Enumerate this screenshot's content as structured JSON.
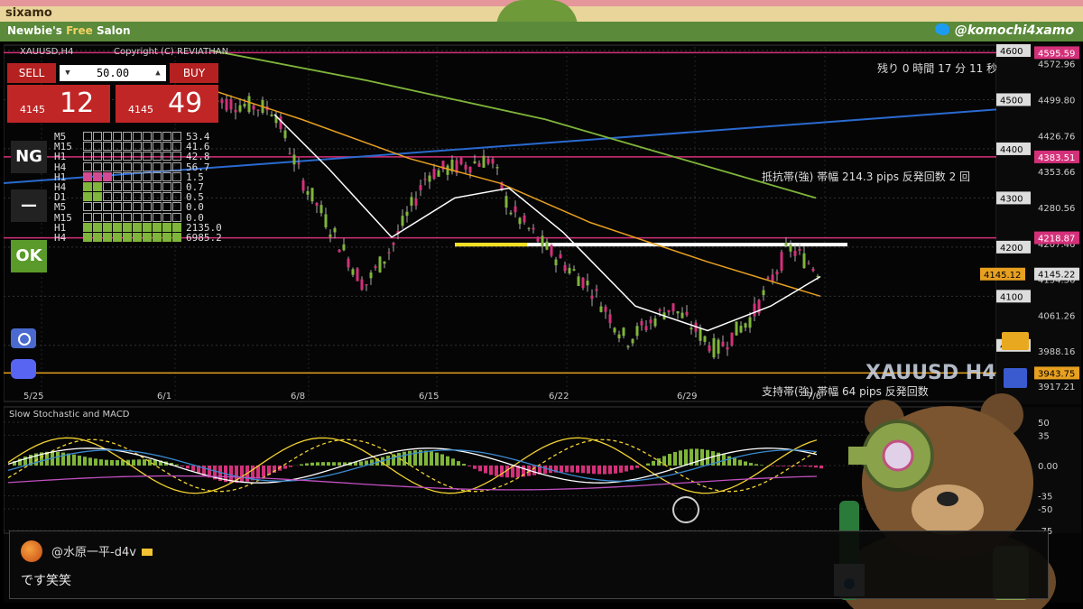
{
  "stream": {
    "brand": "sixamo",
    "salon_prefix": "Newbie's",
    "salon_highlight": "Free",
    "salon_suffix": "Salon",
    "twitter": "@komochi4xamo"
  },
  "chart": {
    "symbol_title": "XAUUSD,H4",
    "copyright": "Copyright (C) REVIATHAN",
    "countdown": "残り 0 時間 17 分 11 秒",
    "resistance_note": "抵抗帯(強) 帯幅 214.3 pips 反発回数 2 回",
    "support_note": "支持帯(強) 帯幅 64 pips 反発回数",
    "watermark": "XAUUSD H4",
    "subwindow_title": "Slow Stochastic and MACD",
    "price_axis": [
      "4572.96",
      "4499.80",
      "4426.76",
      "4353.66",
      "4280.56",
      "4207.46",
      "4134.36",
      "4061.26",
      "3988.16",
      "3917.21"
    ],
    "price_levels": [
      "4600",
      "4500",
      "4400",
      "4300",
      "4200",
      "4100",
      "4000"
    ],
    "level_tags": {
      "top": "4595.59",
      "resistance": "4383.51",
      "upper_band": "4218.87",
      "current_bid": "4145.12",
      "current_ask": "4145.22",
      "support": "3943.75"
    },
    "dates": [
      "5/25",
      "6/1",
      "6/8",
      "6/15",
      "6/22",
      "6/29",
      "7/6"
    ],
    "sub_axis": [
      "50",
      "35",
      "0.00",
      "-35",
      "-50",
      "-75"
    ]
  },
  "trade": {
    "sell_label": "SELL",
    "buy_label": "BUY",
    "lot": "50.00",
    "sell_prefix": "4145",
    "sell_price": "12",
    "buy_prefix": "4145",
    "buy_price": "49"
  },
  "mtf_panel": {
    "rows": [
      {
        "tf": "M5",
        "val": "53.4"
      },
      {
        "tf": "M15",
        "val": "41.6"
      },
      {
        "tf": "H1",
        "val": "42.8"
      },
      {
        "tf": "H4",
        "val": "56.7"
      },
      {
        "tf": "H1",
        "val": "1.5"
      },
      {
        "tf": "H4",
        "val": "0.7"
      },
      {
        "tf": "D1",
        "val": "0.5"
      },
      {
        "tf": "M5",
        "val": "0.0"
      },
      {
        "tf": "M15",
        "val": "0.0"
      },
      {
        "tf": "H1",
        "val": "2135.0"
      },
      {
        "tf": "H4",
        "val": "6985.2"
      }
    ],
    "ng_label": "NG",
    "dash_label": "—",
    "ok_label": "OK"
  },
  "comment": {
    "user": "@水原一平-d4v",
    "message": "です笑笑"
  },
  "colors": {
    "candle_up": "#7fb53a",
    "candle_down": "#d4307a",
    "trend_blue": "#2a6ad0",
    "ma_long": "#7fb53a",
    "ma_mid": "#e8a020",
    "ma_fast": "#ffffff",
    "level_magenta": "#d4307a",
    "sell_red": "#c12626"
  },
  "icons": {
    "camera": "camera-icon",
    "discord": "discord-icon",
    "folder": "folder-icon",
    "save": "save-icon"
  }
}
